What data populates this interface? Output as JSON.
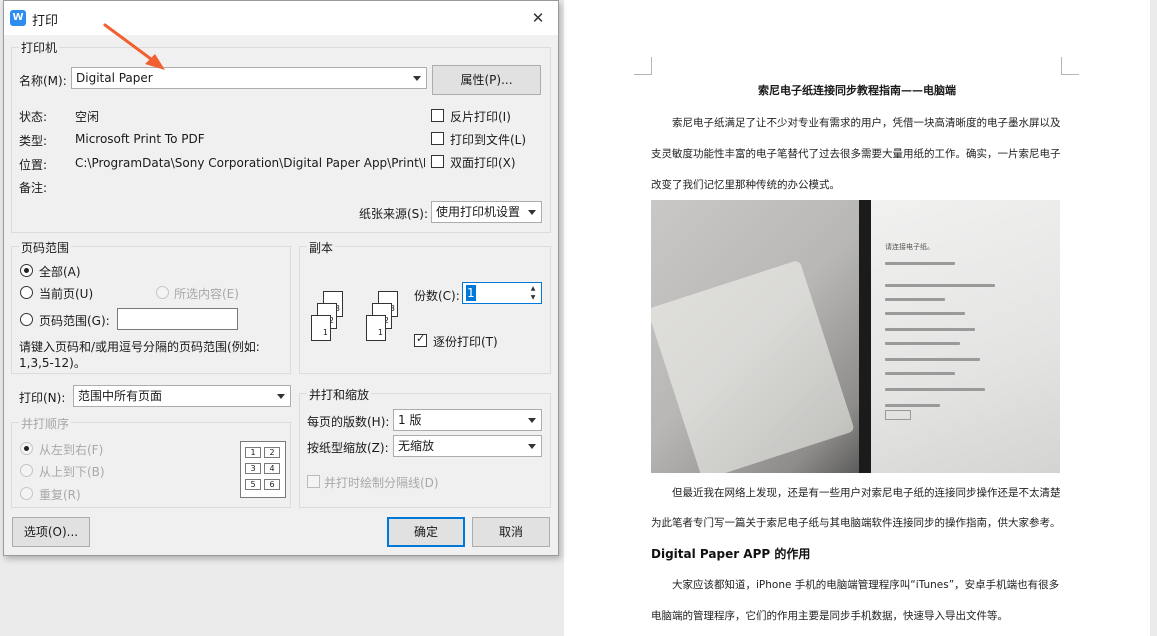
{
  "dialog": {
    "title": "打印",
    "app_icon_glyph": "W",
    "printer_group": {
      "label": "打印机",
      "name_label": "名称(M):",
      "name_value": "Digital Paper",
      "properties_button": "属性(P)...",
      "status_label": "状态:",
      "status_value": "空闲",
      "type_label": "类型:",
      "type_value": "Microsoft Print To PDF",
      "location_label": "位置:",
      "location_value": "C:\\ProgramData\\Sony Corporation\\Digital Paper App\\Print\\F",
      "comment_label": "备注:",
      "reverse_print": "反片打印(I)",
      "print_to_file": "打印到文件(L)",
      "duplex": "双面打印(X)",
      "paper_source_label": "纸张来源(S):",
      "paper_source_value": "使用打印机设置"
    },
    "page_range_group": {
      "label": "页码范围",
      "all": "全部(A)",
      "current_page": "当前页(U)",
      "selection": "所选内容(E)",
      "pages": "页码范围(G):",
      "pages_value": "",
      "hint_line1": "请键入页码和/或用逗号分隔的页码范围(例如:",
      "hint_line2": "1,3,5-12)。"
    },
    "copies_group": {
      "label": "副本",
      "copies_label": "份数(C):",
      "copies_value": "1",
      "collate": "逐份打印(T)",
      "collate_checked": true,
      "icon_pages": [
        "1",
        "2",
        "3",
        "1",
        "2",
        "3"
      ]
    },
    "print_what": {
      "label": "打印(N):",
      "value": "范围中所有页面"
    },
    "order_group": {
      "label": "并打顺序",
      "left_to_right": "从左到右(F)",
      "top_to_bottom": "从上到下(B)",
      "repeat": "重复(R)",
      "grid_numbers": [
        "1",
        "2",
        "3",
        "4",
        "5",
        "6"
      ]
    },
    "zoom_group": {
      "label": "并打和缩放",
      "pages_per_sheet_label": "每页的版数(H):",
      "pages_per_sheet_value": "1 版",
      "scale_label": "按纸型缩放(Z):",
      "scale_value": "无缩放",
      "draw_divider": "并打时绘制分隔线(D)"
    },
    "buttons": {
      "options": "选项(O)...",
      "ok": "确定",
      "cancel": "取消"
    }
  },
  "document": {
    "title": "索尼电子纸连接同步教程指南——电脑端",
    "paragraph1_lines": [
      "索尼电子纸满足了让不少对专业有需求的用户，凭借一块高清晰度的电子墨水屏以及一",
      "支灵敏度功能性丰富的电子笔替代了过去很多需要大量用纸的工作。确实，一片索尼电子纸",
      "改变了我们记忆里那种传统的办公模式。"
    ],
    "paragraph2_lines": [
      "但最近我在网络上发现，还是有一些用户对索尼电子纸的连接同步操作还是不太清楚，",
      "为此笔者专门写一篇关于索尼电子纸与其电脑端软件连接同步的操作指南，供大家参考。"
    ],
    "heading": "Digital Paper APP 的作用",
    "paragraph3_lines": [
      "大家应该都知道，iPhone 手机的电脑端管理程序叫“iTunes”，安卓手机端也有很多",
      "电脑端的管理程序，它们的作用主要是同步手机数据，快速导入导出文件等。"
    ],
    "photo_screen_text": "请连接电子纸。"
  },
  "colors": {
    "accent": "#0078d7",
    "annotation_arrow": "#f06030",
    "app_icon": "#2d8cf0"
  }
}
